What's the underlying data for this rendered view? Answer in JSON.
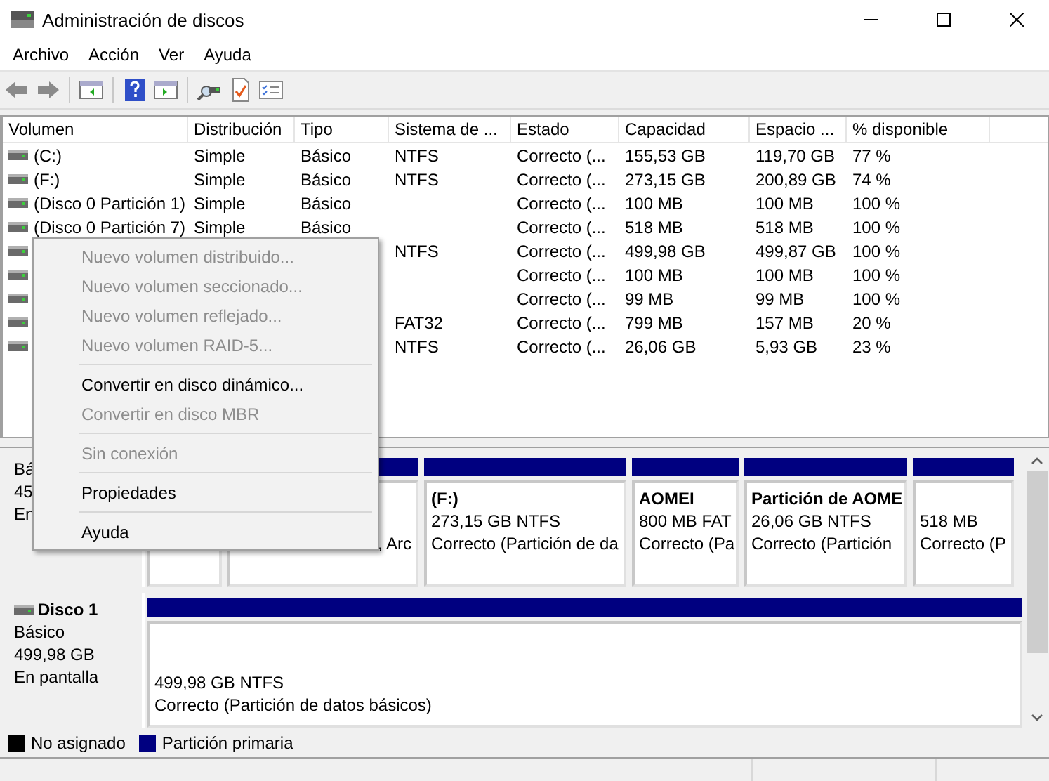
{
  "window": {
    "title": "Administración de discos"
  },
  "menu_bar": [
    "Archivo",
    "Acción",
    "Ver",
    "Ayuda"
  ],
  "table": {
    "columns": [
      "Volumen",
      "Distribución",
      "Tipo",
      "Sistema de ...",
      "Estado",
      "Capacidad",
      "Espacio ...",
      "% disponible"
    ],
    "rows": [
      {
        "volume": "(C:)",
        "layout": "Simple",
        "type": "Básico",
        "file_system": "NTFS",
        "status": "Correcto (...",
        "capacity": "155,53 GB",
        "free_space": "119,70 GB",
        "percent_free": "77 %"
      },
      {
        "volume": "(F:)",
        "layout": "Simple",
        "type": "Básico",
        "file_system": "NTFS",
        "status": "Correcto (...",
        "capacity": "273,15 GB",
        "free_space": "200,89 GB",
        "percent_free": "74 %"
      },
      {
        "volume": "(Disco 0 Partición 1)",
        "layout": "Simple",
        "type": "Básico",
        "status": "Correcto (...",
        "capacity": "100 MB",
        "free_space": "100 MB",
        "percent_free": "100 %"
      },
      {
        "volume": "(Disco 0 Partición 7)",
        "layout": "Simple",
        "type": "Básico",
        "status": "Correcto (...",
        "capacity": "518 MB",
        "free_space": "518 MB",
        "percent_free": "100 %"
      },
      {
        "file_system": "NTFS",
        "status": "Correcto (...",
        "capacity": "499,98 GB",
        "free_space": "499,87 GB",
        "percent_free": "100 %"
      },
      {
        "status": "Correcto (...",
        "capacity": "100 MB",
        "free_space": "100 MB",
        "percent_free": "100 %"
      },
      {
        "status": "Correcto (...",
        "capacity": "99 MB",
        "free_space": "99 MB",
        "percent_free": "100 %"
      },
      {
        "file_system": "FAT32",
        "status": "Correcto (...",
        "capacity": "799 MB",
        "free_space": "157 MB",
        "percent_free": "20 %"
      },
      {
        "file_system": "NTFS",
        "status": "Correcto (...",
        "capacity": "26,06 GB",
        "free_space": "5,93 GB",
        "percent_free": "23 %"
      }
    ]
  },
  "disks": [
    {
      "lines": [
        "Bá",
        "45",
        "En"
      ],
      "partitions": [
        {
          "kind": "partition"
        },
        {
          "kind": "partition",
          "color": "#000080",
          "status": ", Arc"
        },
        {
          "kind": "partition",
          "color": "#000080",
          "title": "(F:)",
          "size": "273,15 GB NTFS",
          "status": "Correcto (Partición de da"
        },
        {
          "kind": "partition",
          "color": "#000080",
          "title": "AOMEI",
          "size": "800 MB FAT",
          "status": "Correcto (Pa"
        },
        {
          "kind": "partition",
          "color": "#000080",
          "title": "Partición de AOME",
          "size": "26,06 GB NTFS",
          "status": "Correcto (Partición"
        },
        {
          "kind": "partition",
          "color": "#000080",
          "size": "518 MB",
          "status": "Correcto (P"
        }
      ]
    },
    {
      "name": "Disco 1",
      "lines": [
        "Básico",
        "499,98 GB",
        "En pantalla"
      ],
      "partitions": [
        {
          "kind": "partition",
          "color": "#000080",
          "size": "499,98 GB NTFS",
          "status": "Correcto (Partición de datos básicos)"
        }
      ]
    }
  ],
  "legend": [
    {
      "label": "No asignado",
      "color": "#000000"
    },
    {
      "label": "Partición primaria",
      "color": "#000080"
    }
  ],
  "context_menu": {
    "items": [
      {
        "kind": "item",
        "label": "Nuevo volumen distribuido...",
        "disabled": true
      },
      {
        "kind": "item",
        "label": "Nuevo volumen seccionado...",
        "disabled": true
      },
      {
        "kind": "item",
        "label": "Nuevo volumen reflejado...",
        "disabled": true
      },
      {
        "kind": "item",
        "label": "Nuevo volumen RAID-5...",
        "disabled": true
      },
      {
        "kind": "separator"
      },
      {
        "kind": "item",
        "label": "Convertir en disco dinámico...",
        "disabled": false
      },
      {
        "kind": "item",
        "label": "Convertir en disco MBR",
        "disabled": true
      },
      {
        "kind": "separator"
      },
      {
        "kind": "item",
        "label": "Sin conexión",
        "disabled": true
      },
      {
        "kind": "separator"
      },
      {
        "kind": "item",
        "label": "Propiedades",
        "disabled": false
      },
      {
        "kind": "separator"
      },
      {
        "kind": "item",
        "label": "Ayuda",
        "disabled": false
      }
    ]
  }
}
